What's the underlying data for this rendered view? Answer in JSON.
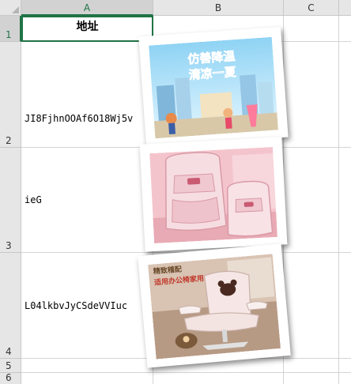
{
  "spreadsheet": {
    "columns": [
      "A",
      "B",
      "C"
    ],
    "rows": [
      "1",
      "2",
      "3",
      "4",
      "5",
      "6"
    ],
    "header_cell": "地址",
    "cells": [
      "JI8FjhnOOAf6O18Wj5v",
      "ieG",
      "L04lkbvJyCSdeVVIuc"
    ]
  },
  "images": [
    {
      "name": "summer-promo-banner",
      "caption": "仿善降温 清凉一夏",
      "icon": "summer-promo-image"
    },
    {
      "name": "pink-school-backpack",
      "icon": "backpack-image"
    },
    {
      "name": "pink-office-chair",
      "caption": "精致稽配 适用办公椅家用",
      "icon": "office-chair-image"
    }
  ],
  "colors": {
    "accent": "#217346",
    "header_bg": "#e6e6e6",
    "grid": "#d4d4d4"
  }
}
